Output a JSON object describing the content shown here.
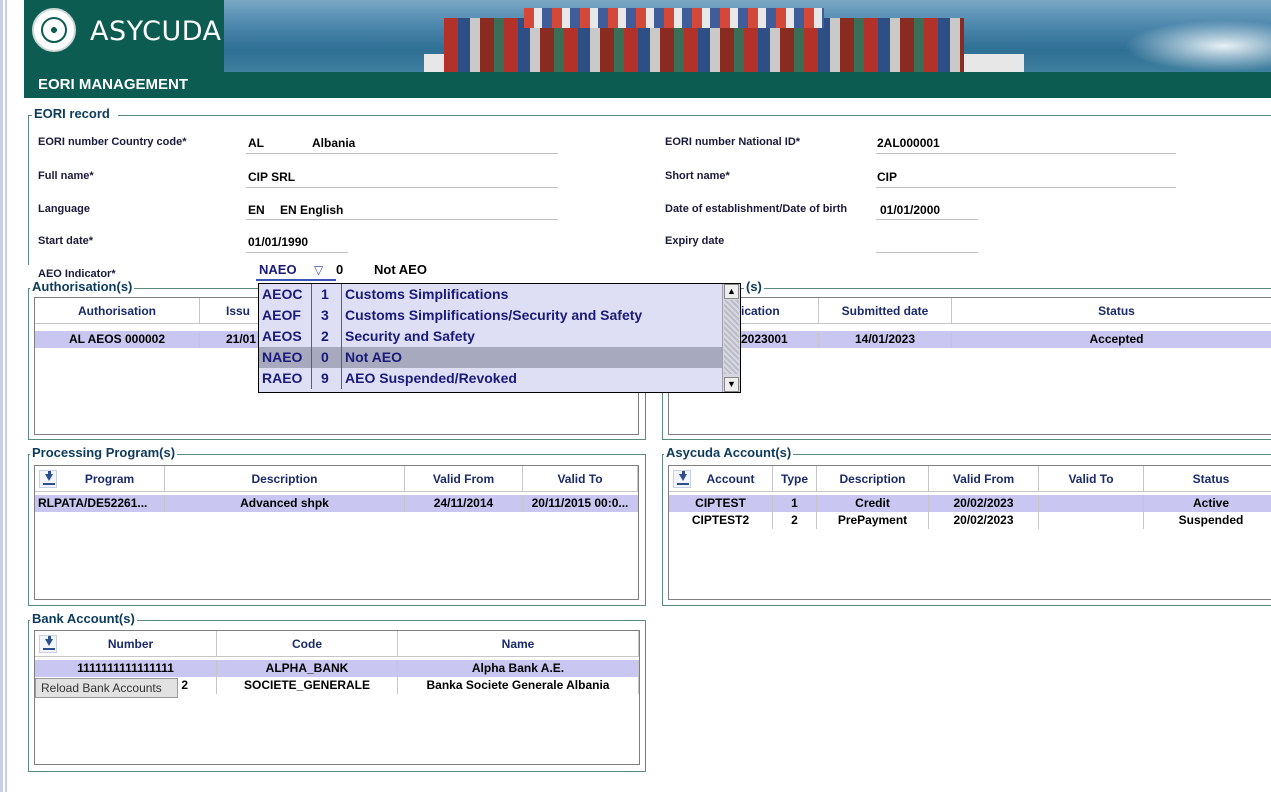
{
  "app": {
    "title": "ASYCUDA",
    "section": "EORI MANAGEMENT"
  },
  "eori_record": {
    "title": "EORI record",
    "country_code_label": "EORI number  Country code*",
    "country_code": "AL",
    "country_name": "Albania",
    "national_id_label": "EORI number  National ID*",
    "national_id": "2AL000001",
    "full_name_label": "Full name*",
    "full_name": "CIP SRL",
    "short_name_label": "Short name*",
    "short_name": "CIP",
    "language_label": "Language",
    "language_code": "EN",
    "language_name": "EN English",
    "establishment_label": "Date of establishment/Date of birth",
    "establishment_date": "01/01/2000",
    "start_date_label": "Start date*",
    "start_date": "01/01/1990",
    "expiry_date_label": "Expiry date",
    "expiry_date": "",
    "aeo_label": "AEO Indicator*",
    "aeo_code": "NAEO",
    "aeo_num": "0",
    "aeo_desc": "Not AEO"
  },
  "aeo_options": [
    {
      "code": "AEOC",
      "num": "1",
      "desc": "Customs Simplifications",
      "selected": false
    },
    {
      "code": "AEOF",
      "num": "3",
      "desc": "Customs Simplifications/Security and Safety",
      "selected": false
    },
    {
      "code": "AEOS",
      "num": "2",
      "desc": "Security and Safety",
      "selected": false
    },
    {
      "code": "NAEO",
      "num": "0",
      "desc": "Not AEO",
      "selected": true
    },
    {
      "code": "RAEO",
      "num": "9",
      "desc": "AEO Suspended/Revoked",
      "selected": false
    }
  ],
  "authorisations": {
    "title": "Authorisation(s)",
    "headers": [
      "Authorisation",
      "Issu"
    ],
    "rows": [
      [
        "AL AEOS 000002",
        "21/01"
      ]
    ]
  },
  "applications": {
    "title": "(s)",
    "headers": [
      "ication",
      "Submitted date",
      "Status"
    ],
    "rows": [
      [
        "2023001",
        "14/01/2023",
        "Accepted"
      ]
    ]
  },
  "processing": {
    "title": "Processing Program(s)",
    "headers": [
      "Program",
      "Description",
      "Valid From",
      "Valid To"
    ],
    "rows": [
      [
        "RLPATA/DE52261...",
        "Advanced shpk",
        "24/11/2014",
        "20/11/2015 00:0..."
      ]
    ]
  },
  "accounts": {
    "title": "Asycuda Account(s)",
    "headers": [
      "Account",
      "Type",
      "Description",
      "Valid From",
      "Valid To",
      "Status"
    ],
    "rows": [
      [
        "CIPTEST",
        "1",
        "Credit",
        "20/02/2023",
        "",
        "Active"
      ],
      [
        "CIPTEST2",
        "2",
        "PrePayment",
        "20/02/2023",
        "",
        "Suspended"
      ]
    ]
  },
  "banks": {
    "title": "Bank Account(s)",
    "headers": [
      "Number",
      "Code",
      "Name"
    ],
    "rows": [
      [
        "1111111111111111",
        "ALPHA_BANK",
        "Alpha Bank A.E."
      ],
      [
        "2",
        "SOCIETE_GENERALE",
        "Banka Societe Generale Albania"
      ]
    ],
    "tooltip": "Reload Bank Accounts"
  },
  "icons": {
    "download": "download-icon",
    "logo": "un-emblem-icon",
    "dropdown": "triangle-down-icon"
  }
}
